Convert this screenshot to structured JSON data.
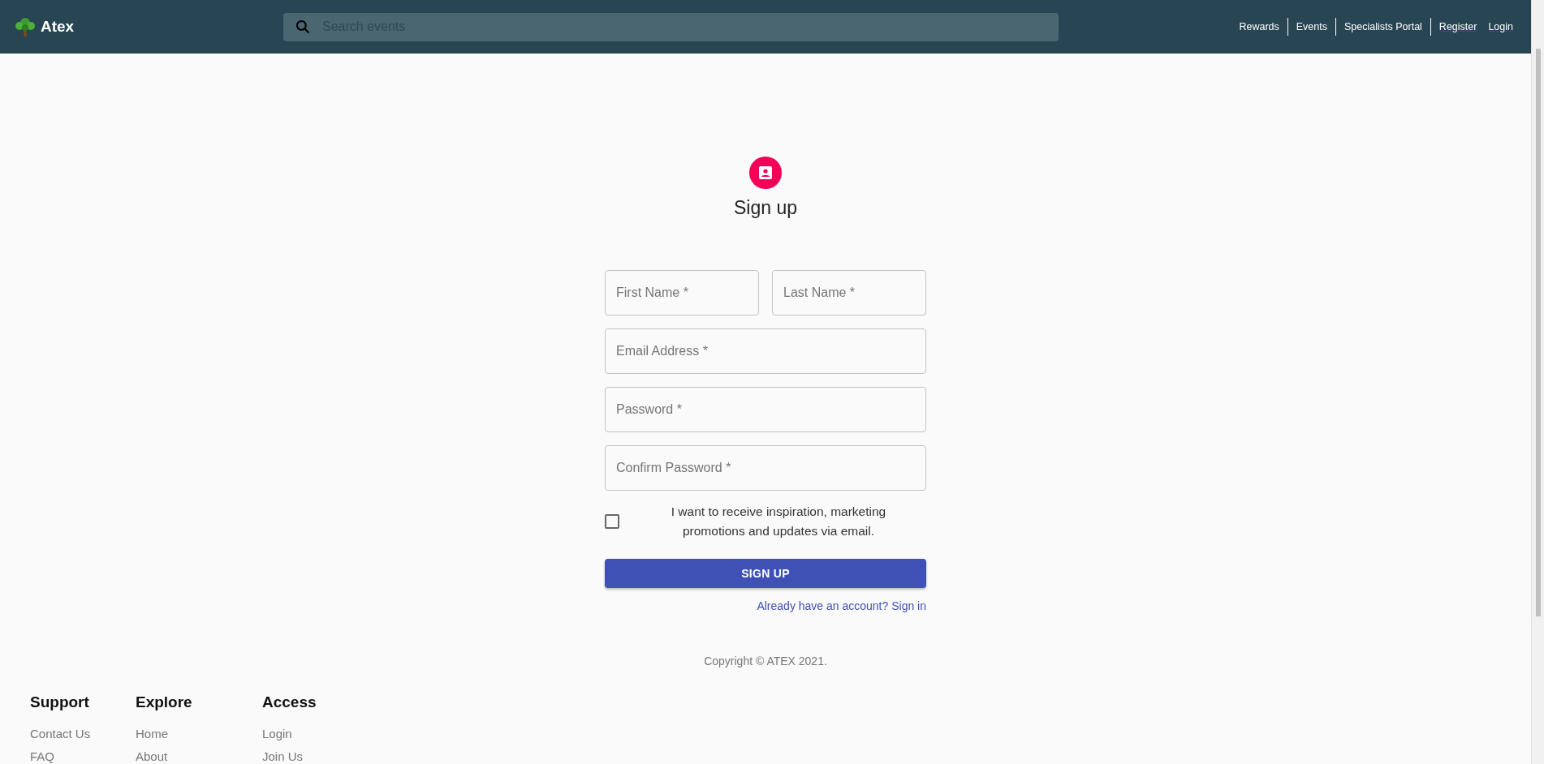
{
  "header": {
    "logo": "Atex",
    "search": {
      "placeholder": "Search events"
    },
    "nav": [
      {
        "label": "Rewards",
        "kind": "divided"
      },
      {
        "label": "Events",
        "kind": "divided"
      },
      {
        "label": "Specialists Portal",
        "kind": "divided"
      },
      {
        "label": "Register",
        "kind": "link"
      },
      {
        "label": "Login",
        "kind": "link"
      }
    ]
  },
  "form": {
    "title": "Sign up",
    "name_fields": [
      {
        "placeholder": "First Name *"
      },
      {
        "placeholder": "Last Name *"
      }
    ],
    "fields": [
      {
        "placeholder": "Email Address *"
      },
      {
        "placeholder": "Password *"
      },
      {
        "placeholder": "Confirm Password *"
      }
    ],
    "consent": {
      "label": "I want to receive inspiration, marketing promotions and updates via email.",
      "checked": false
    },
    "submit": "SIGN UP",
    "signin_link": "Already have an account? Sign in"
  },
  "copyright": "Copyright © ATEX 2021.",
  "footer": {
    "columns": [
      {
        "title": "Support",
        "links": [
          "Contact Us",
          "FAQ"
        ]
      },
      {
        "title": "Explore",
        "links": [
          "Home",
          "About"
        ]
      },
      {
        "title": "Access",
        "links": [
          "Login",
          "Join Us"
        ]
      }
    ]
  }
}
